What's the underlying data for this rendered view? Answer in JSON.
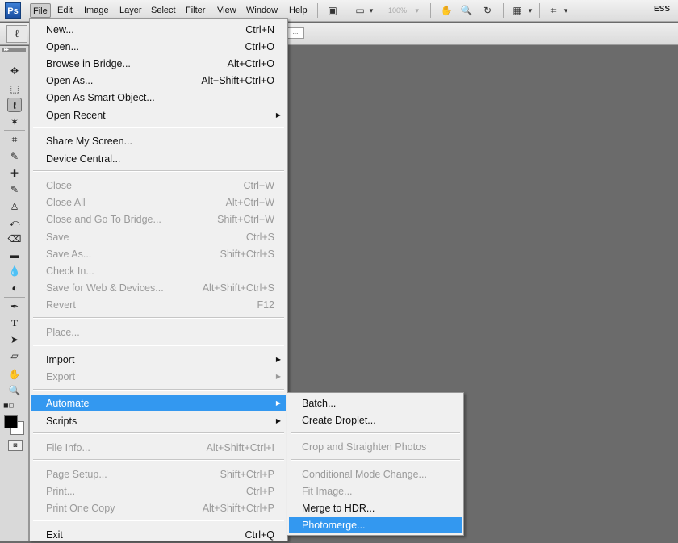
{
  "app": {
    "logo": "Ps"
  },
  "menubar": {
    "items": [
      "File",
      "Edit",
      "Image",
      "Layer",
      "Select",
      "Filter",
      "View",
      "Window",
      "Help"
    ],
    "zoom": "100%",
    "workspace": "ESS"
  },
  "icons": {
    "bridge": "▣",
    "screen_mode": "▭",
    "hand": "✋",
    "zoom": "🔍",
    "rotate": "↻",
    "arrange": "▦",
    "extras": "⌗",
    "dropdown": "▾",
    "lasso": "ℓ",
    "move": "✥",
    "marquee": "⬚",
    "magic_wand": "✶",
    "crop": "⌗",
    "eyedropper": "✎",
    "healing": "✚",
    "brush": "✎",
    "stamp": "♙",
    "history_brush": "⤺",
    "eraser": "⌫",
    "gradient": "▬",
    "blur": "💧",
    "dodge": "◐",
    "pen": "✒",
    "type": "T",
    "path_select": "➤",
    "shape": "▱",
    "hand_tool": "✋",
    "zoom_tool": "🔍",
    "mini_colors": "◼◻",
    "quick_mask": "◙",
    "submenu_arrow": "▶"
  },
  "file_menu": {
    "items": [
      {
        "label": "New...",
        "shortcut": "Ctrl+N"
      },
      {
        "label": "Open...",
        "shortcut": "Ctrl+O"
      },
      {
        "label": "Browse in Bridge...",
        "shortcut": "Alt+Ctrl+O"
      },
      {
        "label": "Open As...",
        "shortcut": "Alt+Shift+Ctrl+O"
      },
      {
        "label": "Open As Smart Object...",
        "shortcut": ""
      },
      {
        "label": "Open Recent",
        "shortcut": ""
      },
      {
        "label": "Share My Screen...",
        "shortcut": ""
      },
      {
        "label": "Device Central...",
        "shortcut": ""
      },
      {
        "label": "Close",
        "shortcut": "Ctrl+W"
      },
      {
        "label": "Close All",
        "shortcut": "Alt+Ctrl+W"
      },
      {
        "label": "Close and Go To Bridge...",
        "shortcut": "Shift+Ctrl+W"
      },
      {
        "label": "Save",
        "shortcut": "Ctrl+S"
      },
      {
        "label": "Save As...",
        "shortcut": "Shift+Ctrl+S"
      },
      {
        "label": "Check In...",
        "shortcut": ""
      },
      {
        "label": "Save for Web & Devices...",
        "shortcut": "Alt+Shift+Ctrl+S"
      },
      {
        "label": "Revert",
        "shortcut": "F12"
      },
      {
        "label": "Place...",
        "shortcut": ""
      },
      {
        "label": "Import",
        "shortcut": ""
      },
      {
        "label": "Export",
        "shortcut": ""
      },
      {
        "label": "Automate",
        "shortcut": ""
      },
      {
        "label": "Scripts",
        "shortcut": ""
      },
      {
        "label": "File Info...",
        "shortcut": "Alt+Shift+Ctrl+I"
      },
      {
        "label": "Page Setup...",
        "shortcut": "Shift+Ctrl+P"
      },
      {
        "label": "Print...",
        "shortcut": "Ctrl+P"
      },
      {
        "label": "Print One Copy",
        "shortcut": "Alt+Shift+Ctrl+P"
      },
      {
        "label": "Exit",
        "shortcut": "Ctrl+Q"
      }
    ]
  },
  "automate_menu": {
    "items": [
      {
        "label": "Batch..."
      },
      {
        "label": "Create Droplet..."
      },
      {
        "label": "Crop and Straighten Photos"
      },
      {
        "label": "Conditional Mode Change..."
      },
      {
        "label": "Fit Image..."
      },
      {
        "label": "Merge to HDR..."
      },
      {
        "label": "Photomerge..."
      }
    ]
  }
}
